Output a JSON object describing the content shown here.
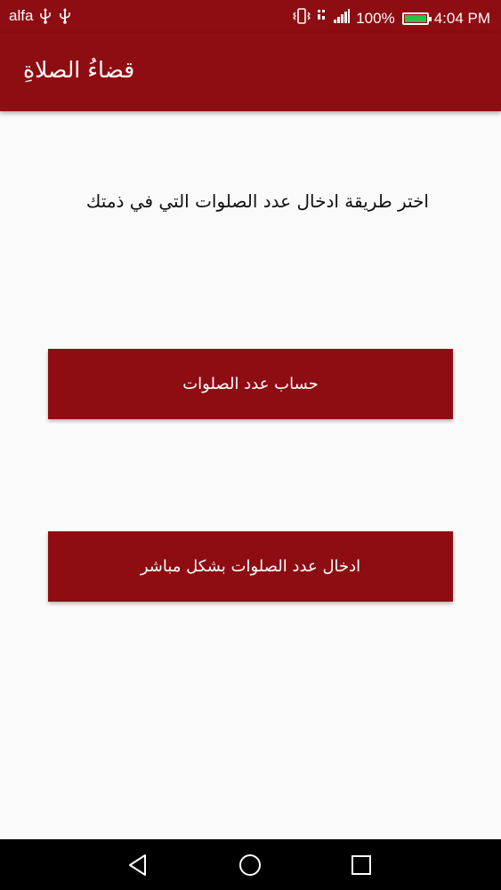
{
  "status_bar": {
    "carrier": "alfa",
    "battery_percent": "100%",
    "battery_level": 1.0,
    "time": "4:04 PM",
    "icons": [
      "usb-icon",
      "usb-icon",
      "vibrate-icon",
      "no-sim-icon",
      "signal-icon",
      "battery-icon"
    ]
  },
  "app_bar": {
    "title": "قضاءُ الصلاةِ"
  },
  "main": {
    "instruction": "اختر طريقة  ادخال عدد الصلوات التي في ذمتك",
    "buttons": [
      {
        "label": "حساب عدد الصلوات"
      },
      {
        "label": "ادخال عدد الصلوات بشكل مباشر"
      }
    ]
  },
  "nav_bar": {
    "icons": [
      "back-icon",
      "home-icon",
      "recents-icon"
    ]
  },
  "colors": {
    "primary": "#8e0d12",
    "background": "#fafafa",
    "battery_fill": "#27c24c"
  }
}
